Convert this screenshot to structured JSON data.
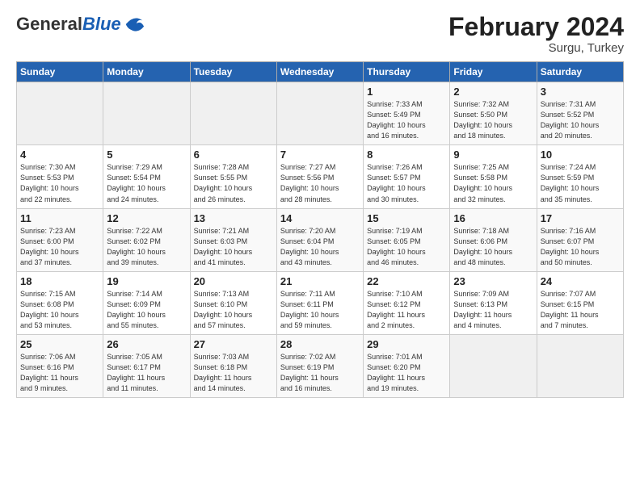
{
  "header": {
    "logo_line1": "General",
    "logo_line2": "Blue",
    "title": "February 2024",
    "subtitle": "Surgu, Turkey"
  },
  "days_of_week": [
    "Sunday",
    "Monday",
    "Tuesday",
    "Wednesday",
    "Thursday",
    "Friday",
    "Saturday"
  ],
  "weeks": [
    [
      {
        "num": "",
        "info": ""
      },
      {
        "num": "",
        "info": ""
      },
      {
        "num": "",
        "info": ""
      },
      {
        "num": "",
        "info": ""
      },
      {
        "num": "1",
        "info": "Sunrise: 7:33 AM\nSunset: 5:49 PM\nDaylight: 10 hours\nand 16 minutes."
      },
      {
        "num": "2",
        "info": "Sunrise: 7:32 AM\nSunset: 5:50 PM\nDaylight: 10 hours\nand 18 minutes."
      },
      {
        "num": "3",
        "info": "Sunrise: 7:31 AM\nSunset: 5:52 PM\nDaylight: 10 hours\nand 20 minutes."
      }
    ],
    [
      {
        "num": "4",
        "info": "Sunrise: 7:30 AM\nSunset: 5:53 PM\nDaylight: 10 hours\nand 22 minutes."
      },
      {
        "num": "5",
        "info": "Sunrise: 7:29 AM\nSunset: 5:54 PM\nDaylight: 10 hours\nand 24 minutes."
      },
      {
        "num": "6",
        "info": "Sunrise: 7:28 AM\nSunset: 5:55 PM\nDaylight: 10 hours\nand 26 minutes."
      },
      {
        "num": "7",
        "info": "Sunrise: 7:27 AM\nSunset: 5:56 PM\nDaylight: 10 hours\nand 28 minutes."
      },
      {
        "num": "8",
        "info": "Sunrise: 7:26 AM\nSunset: 5:57 PM\nDaylight: 10 hours\nand 30 minutes."
      },
      {
        "num": "9",
        "info": "Sunrise: 7:25 AM\nSunset: 5:58 PM\nDaylight: 10 hours\nand 32 minutes."
      },
      {
        "num": "10",
        "info": "Sunrise: 7:24 AM\nSunset: 5:59 PM\nDaylight: 10 hours\nand 35 minutes."
      }
    ],
    [
      {
        "num": "11",
        "info": "Sunrise: 7:23 AM\nSunset: 6:00 PM\nDaylight: 10 hours\nand 37 minutes."
      },
      {
        "num": "12",
        "info": "Sunrise: 7:22 AM\nSunset: 6:02 PM\nDaylight: 10 hours\nand 39 minutes."
      },
      {
        "num": "13",
        "info": "Sunrise: 7:21 AM\nSunset: 6:03 PM\nDaylight: 10 hours\nand 41 minutes."
      },
      {
        "num": "14",
        "info": "Sunrise: 7:20 AM\nSunset: 6:04 PM\nDaylight: 10 hours\nand 43 minutes."
      },
      {
        "num": "15",
        "info": "Sunrise: 7:19 AM\nSunset: 6:05 PM\nDaylight: 10 hours\nand 46 minutes."
      },
      {
        "num": "16",
        "info": "Sunrise: 7:18 AM\nSunset: 6:06 PM\nDaylight: 10 hours\nand 48 minutes."
      },
      {
        "num": "17",
        "info": "Sunrise: 7:16 AM\nSunset: 6:07 PM\nDaylight: 10 hours\nand 50 minutes."
      }
    ],
    [
      {
        "num": "18",
        "info": "Sunrise: 7:15 AM\nSunset: 6:08 PM\nDaylight: 10 hours\nand 53 minutes."
      },
      {
        "num": "19",
        "info": "Sunrise: 7:14 AM\nSunset: 6:09 PM\nDaylight: 10 hours\nand 55 minutes."
      },
      {
        "num": "20",
        "info": "Sunrise: 7:13 AM\nSunset: 6:10 PM\nDaylight: 10 hours\nand 57 minutes."
      },
      {
        "num": "21",
        "info": "Sunrise: 7:11 AM\nSunset: 6:11 PM\nDaylight: 10 hours\nand 59 minutes."
      },
      {
        "num": "22",
        "info": "Sunrise: 7:10 AM\nSunset: 6:12 PM\nDaylight: 11 hours\nand 2 minutes."
      },
      {
        "num": "23",
        "info": "Sunrise: 7:09 AM\nSunset: 6:13 PM\nDaylight: 11 hours\nand 4 minutes."
      },
      {
        "num": "24",
        "info": "Sunrise: 7:07 AM\nSunset: 6:15 PM\nDaylight: 11 hours\nand 7 minutes."
      }
    ],
    [
      {
        "num": "25",
        "info": "Sunrise: 7:06 AM\nSunset: 6:16 PM\nDaylight: 11 hours\nand 9 minutes."
      },
      {
        "num": "26",
        "info": "Sunrise: 7:05 AM\nSunset: 6:17 PM\nDaylight: 11 hours\nand 11 minutes."
      },
      {
        "num": "27",
        "info": "Sunrise: 7:03 AM\nSunset: 6:18 PM\nDaylight: 11 hours\nand 14 minutes."
      },
      {
        "num": "28",
        "info": "Sunrise: 7:02 AM\nSunset: 6:19 PM\nDaylight: 11 hours\nand 16 minutes."
      },
      {
        "num": "29",
        "info": "Sunrise: 7:01 AM\nSunset: 6:20 PM\nDaylight: 11 hours\nand 19 minutes."
      },
      {
        "num": "",
        "info": ""
      },
      {
        "num": "",
        "info": ""
      }
    ]
  ]
}
